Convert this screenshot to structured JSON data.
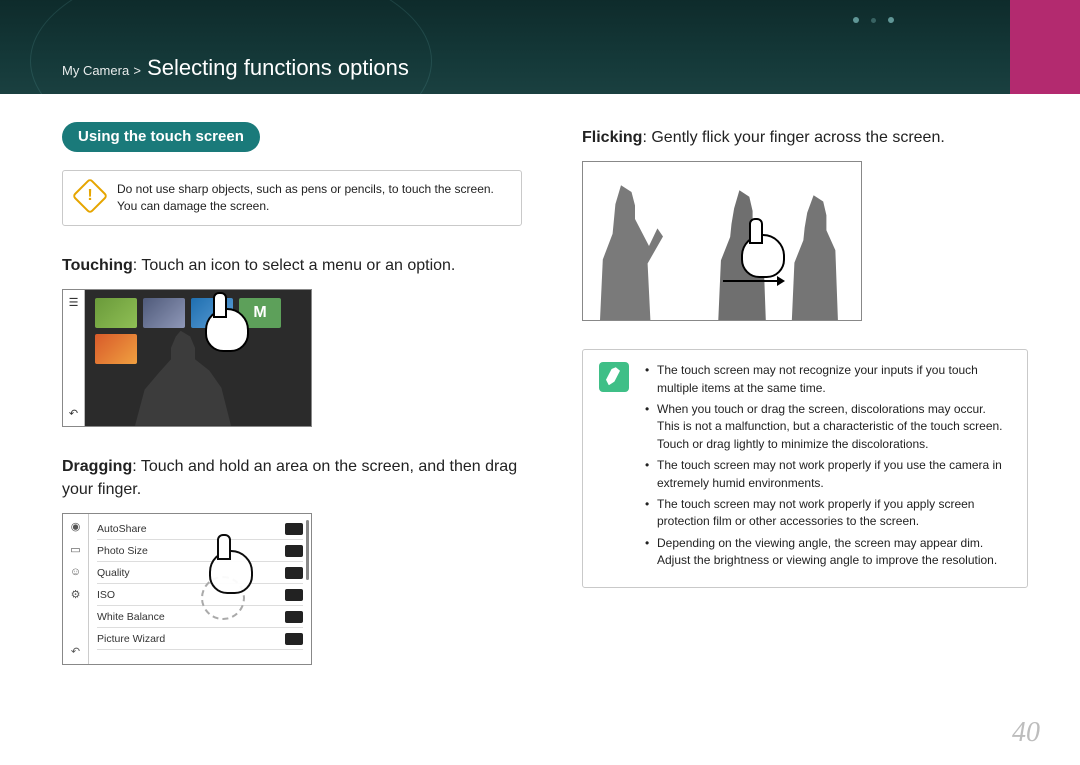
{
  "breadcrumb": {
    "parent": "My Camera",
    "sep": ">",
    "title": "Selecting functions options"
  },
  "left": {
    "section_pill": "Using the touch screen",
    "warning": "Do not use sharp objects, such as pens or pencils, to touch the screen. You can damage the screen.",
    "touching_label": "Touching",
    "touching_text": ": Touch an icon to select a menu or an option.",
    "dragging_label": "Dragging",
    "dragging_text": ": Touch and hold an area on the screen, and then drag your finger.",
    "drag_list": {
      "rows": [
        {
          "label": "AutoShare"
        },
        {
          "label": "Photo Size"
        },
        {
          "label": "Quality"
        },
        {
          "label": "ISO"
        },
        {
          "label": "White Balance"
        },
        {
          "label": "Picture Wizard"
        }
      ]
    },
    "touch_illus": {
      "mode_label": "M"
    }
  },
  "right": {
    "flicking_label": "Flicking",
    "flicking_text": ": Gently flick your finger across the screen.",
    "notes": [
      "The touch screen may not recognize your inputs if you touch multiple items at the same time.",
      "When you touch or drag the screen, discolorations may occur. This is not a malfunction, but a characteristic of the touch screen. Touch or drag lightly to minimize the discolorations.",
      "The touch screen may not work properly if you use the camera in extremely humid environments.",
      "The touch screen may not work properly if you apply screen protection film or other accessories to the screen.",
      "Depending on the viewing angle, the screen may appear dim. Adjust the brightness or viewing angle to improve the resolution."
    ]
  },
  "page_number": "40"
}
